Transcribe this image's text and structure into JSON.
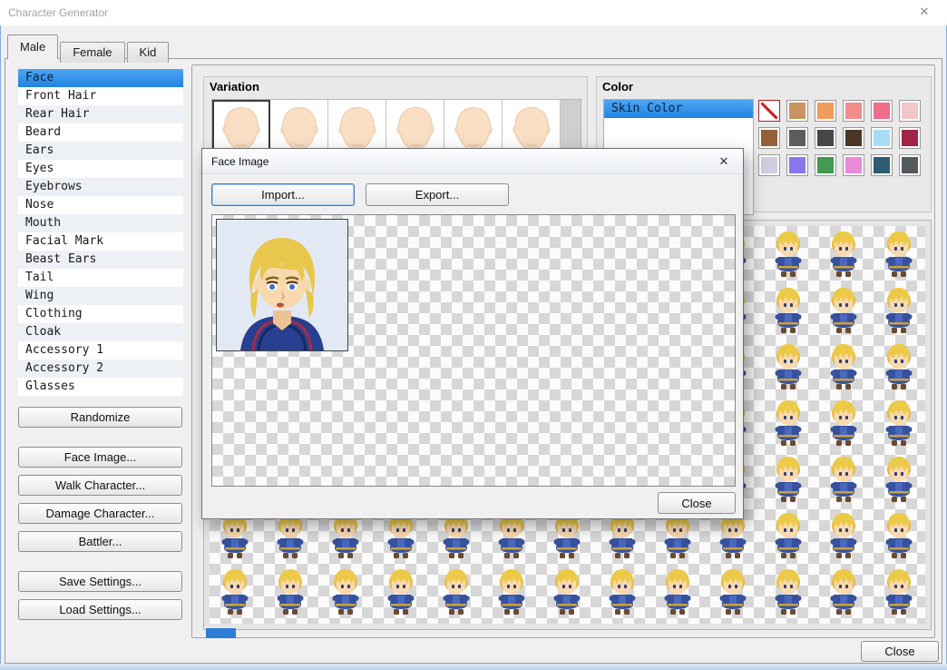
{
  "window": {
    "title": "Character Generator",
    "close_glyph": "✕"
  },
  "tabs": {
    "items": [
      "Male",
      "Female",
      "Kid"
    ],
    "selected": "Male"
  },
  "sidebar": {
    "items": [
      "Face",
      "Front Hair",
      "Rear Hair",
      "Beard",
      "Ears",
      "Eyes",
      "Eyebrows",
      "Nose",
      "Mouth",
      "Facial Mark",
      "Beast Ears",
      "Tail",
      "Wing",
      "Clothing",
      "Cloak",
      "Accessory 1",
      "Accessory 2",
      "Glasses"
    ],
    "selected_index": 0
  },
  "actions": {
    "randomize": "Randomize",
    "face_image": "Face Image...",
    "walk_character": "Walk Character...",
    "damage_character": "Damage Character...",
    "battler": "Battler...",
    "save_settings": "Save Settings...",
    "load_settings": "Load Settings..."
  },
  "variation": {
    "title": "Variation",
    "thumbnail_count": 6,
    "selected_index": 0
  },
  "color": {
    "title": "Color",
    "list_items": [
      "Skin Color"
    ],
    "selected_index": 0,
    "selected_swatch_index": 0,
    "palette": [
      "none",
      "#c9945f",
      "#ef9b59",
      "#f28c8c",
      "#ee6d8b",
      "#f3c6cb",
      "#94603a",
      "#5c5c5c",
      "#474747",
      "#4c3527",
      "#a9dcf7",
      "#a02445",
      "#d1cce0",
      "#8779ec",
      "#419b51",
      "#ea8bd8",
      "#2d5b6f",
      "#54595f"
    ]
  },
  "preview": {
    "grid_cols": 13,
    "grid_rows": 7
  },
  "dialog": {
    "title": "Face Image",
    "close_glyph": "✕",
    "import_label": "Import...",
    "export_label": "Export...",
    "close_label": "Close"
  },
  "footer": {
    "close_label": "Close"
  }
}
